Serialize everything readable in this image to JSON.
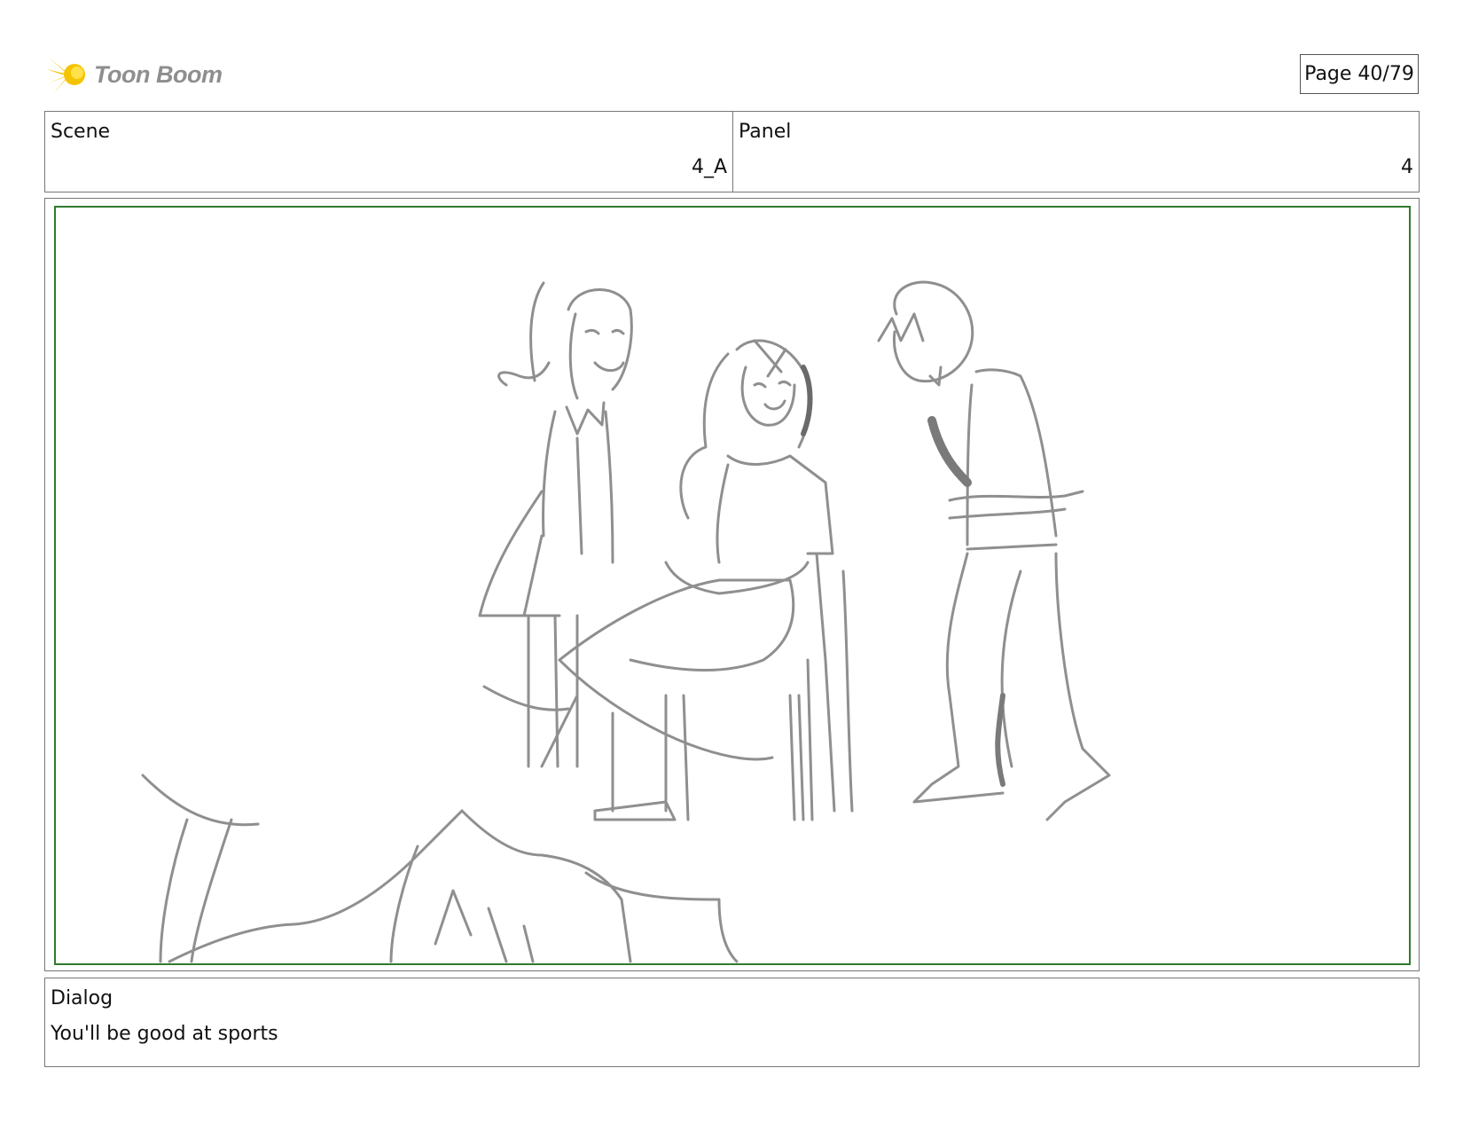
{
  "header": {
    "logo_text": "Toon Boom",
    "logo_icon": "starburst-logo-icon",
    "page_label": "Page 40/79"
  },
  "info": {
    "scene_label": "Scene",
    "scene_value": "4_A",
    "panel_label": "Panel",
    "panel_value": "4"
  },
  "frame": {
    "safe_area_color": "#2f7a2f",
    "sketch": "pencil-sketch-image"
  },
  "dialog": {
    "label": "Dialog",
    "text": "You'll be good at sports"
  }
}
